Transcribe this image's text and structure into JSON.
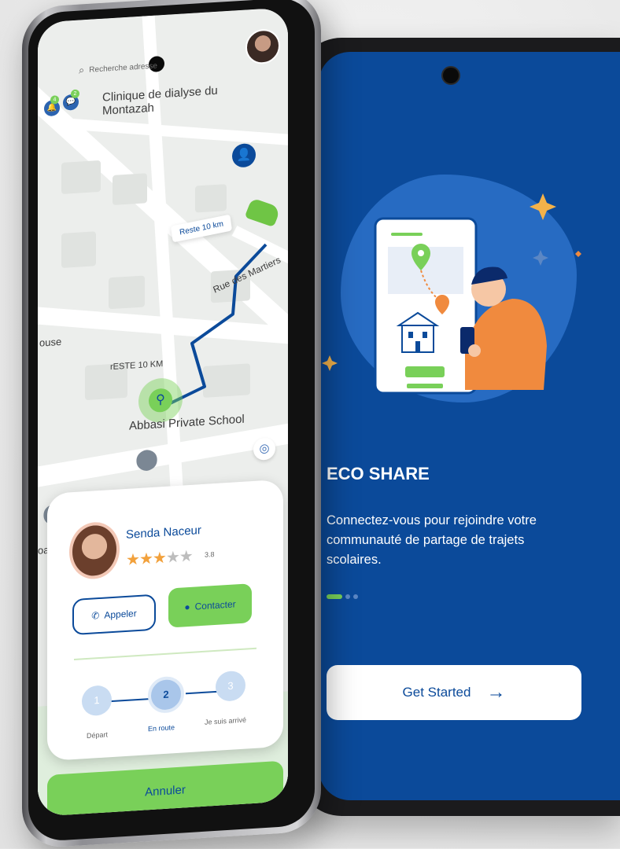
{
  "right_screen": {
    "title": "ECO SHARE",
    "description": "Connectez-vous pour rejoindre votre communauté de partage de trajets scolaires.",
    "get_started_label": "Get Started",
    "pager": {
      "total": 3,
      "active": 1
    },
    "colors": {
      "background": "#0b4a9a",
      "accent": "#79d059"
    }
  },
  "left_screen": {
    "search": {
      "placeholder": "Recherche adresse"
    },
    "notifications": {
      "bell_badge": "4",
      "chat_badge": "2"
    },
    "map_labels": {
      "clinic": "Clinique de dialyse du Montazah",
      "reste_top": "Reste 10 km",
      "street": "Rue des Martiers",
      "reste_mid": "rESTE 10 KM",
      "school": "Abbasi Private School",
      "house": "ouse",
      "edge": "oal"
    },
    "driver": {
      "name": "Senda Naceur",
      "rating": 3.8,
      "rating_text": "3.8"
    },
    "buttons": {
      "call": "Appeler",
      "contact": "Contacter",
      "cancel": "Annuler"
    },
    "steps": [
      {
        "number": "1",
        "label": "Départ"
      },
      {
        "number": "2",
        "label": "En route"
      },
      {
        "number": "3",
        "label": "Je suis arrivé"
      }
    ],
    "current_step": 2
  }
}
